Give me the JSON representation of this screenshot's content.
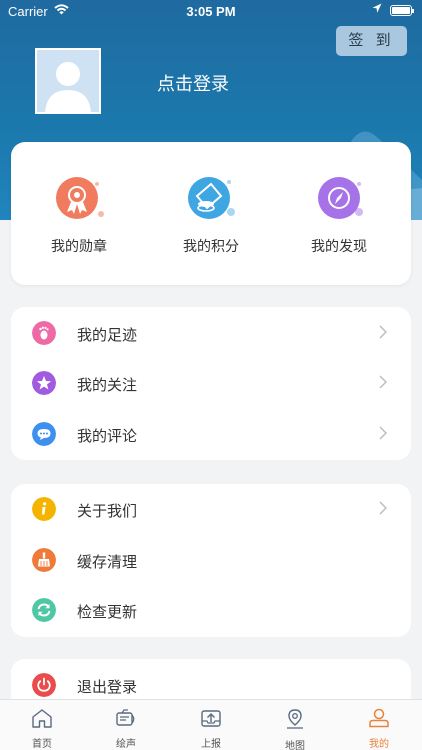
{
  "status_bar": {
    "carrier": "Carrier",
    "time": "3:05 PM"
  },
  "header": {
    "checkin_label": "签 到",
    "login_text": "点击登录"
  },
  "features": [
    {
      "label": "我的勋章",
      "icon": "medal-icon",
      "color": "#f07b5f"
    },
    {
      "label": "我的积分",
      "icon": "coins-icon",
      "color": "#3da6e3"
    },
    {
      "label": "我的发现",
      "icon": "compass-icon",
      "color": "#a672e8"
    }
  ],
  "group1": [
    {
      "label": "我的足迹",
      "icon": "footprint-icon",
      "color": "#ee6aa7"
    },
    {
      "label": "我的关注",
      "icon": "star-icon",
      "color": "#a05be0"
    },
    {
      "label": "我的评论",
      "icon": "comment-icon",
      "color": "#3d8ff0"
    }
  ],
  "group2": [
    {
      "label": "关于我们",
      "icon": "info-icon",
      "color": "#f5b400"
    },
    {
      "label": "缓存清理",
      "icon": "broom-icon",
      "color": "#f07a3a"
    },
    {
      "label": "检查更新",
      "icon": "refresh-icon",
      "color": "#4fc7a5"
    }
  ],
  "group3": [
    {
      "label": "退出登录",
      "icon": "power-icon",
      "color": "#ea4b4b"
    }
  ],
  "tabs": [
    {
      "label": "首页",
      "icon": "home-icon"
    },
    {
      "label": "绘声",
      "icon": "audio-icon"
    },
    {
      "label": "上报",
      "icon": "upload-icon"
    },
    {
      "label": "地图",
      "icon": "map-pin-icon"
    },
    {
      "label": "我的",
      "icon": "profile-icon"
    }
  ],
  "colors": {
    "header": "#1b79ad",
    "accent": "#e8823a"
  }
}
